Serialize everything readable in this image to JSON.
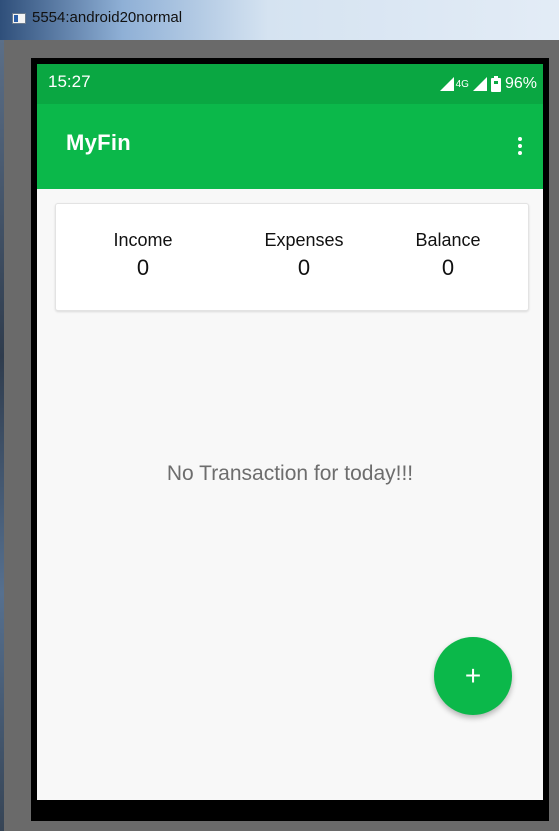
{
  "window": {
    "title": "5554:android20normal"
  },
  "status_bar": {
    "time": "15:27",
    "network": "4G",
    "battery": "96%"
  },
  "app_bar": {
    "title": "MyFin",
    "menu_icon": "more-vert-icon"
  },
  "summary": {
    "income_label": "Income",
    "income_value": "0",
    "expenses_label": "Expenses",
    "expenses_value": "0",
    "balance_label": "Balance",
    "balance_value": "0"
  },
  "empty_state": {
    "message": "No Transaction for today!!!"
  },
  "fab": {
    "label": "+",
    "icon": "add-icon"
  },
  "colors": {
    "status_bar": "#0aa742",
    "app_bar": "#0bb84a",
    "fab": "#0bb84a",
    "background": "#f8f8f8"
  }
}
